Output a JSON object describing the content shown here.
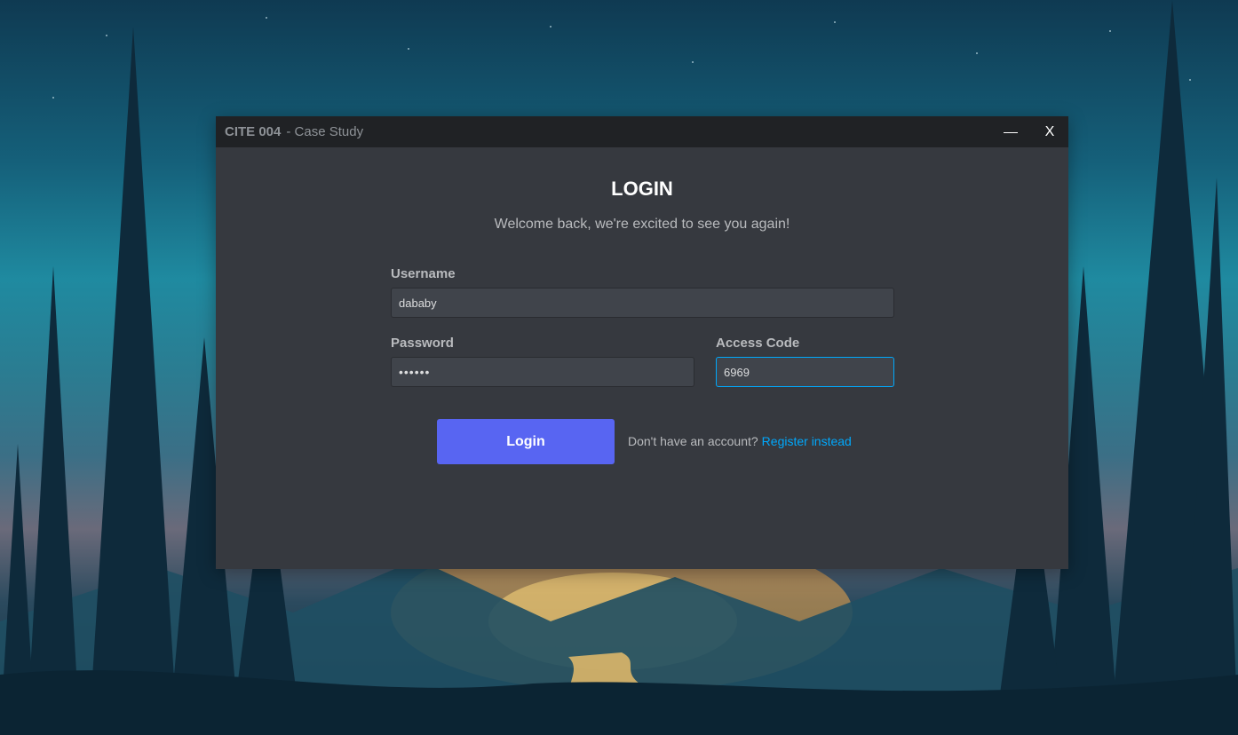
{
  "window": {
    "app_name": "CITE 004",
    "subtitle": "- Case Study",
    "close_label": "X"
  },
  "login": {
    "heading": "LOGIN",
    "welcome": "Welcome back, we're excited to see you again!",
    "username_label": "Username",
    "username_value": "dababy",
    "password_label": "Password",
    "password_value": "••••••",
    "access_label": "Access Code",
    "access_value": "6969",
    "button_label": "Login",
    "register_prompt": "Don't have an account?",
    "register_link": "Register instead"
  },
  "colors": {
    "window_bg": "#36393f",
    "titlebar_bg": "#202225",
    "input_bg": "#40444b",
    "button_accent": "#5865f2",
    "link_accent": "#00a8fc"
  },
  "icons": {
    "minimize": "minimize-icon",
    "close": "close-icon"
  }
}
